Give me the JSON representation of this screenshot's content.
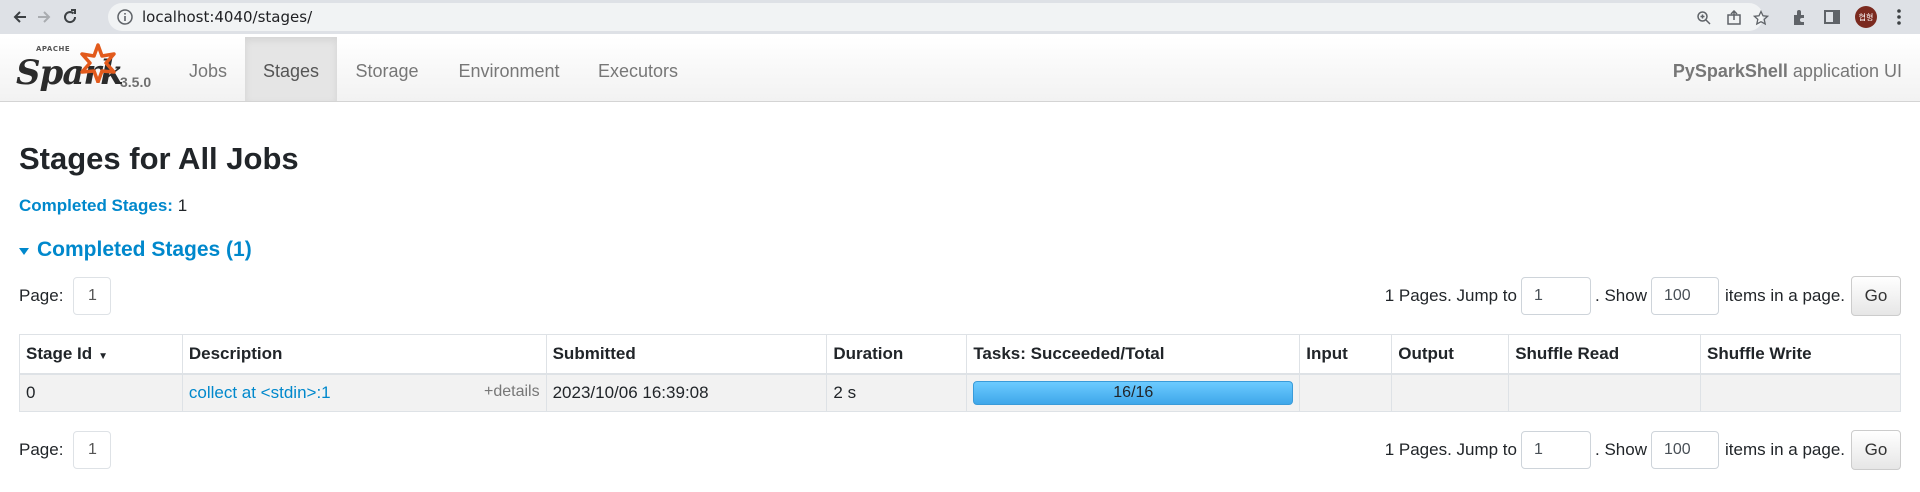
{
  "browser": {
    "url": "localhost:4040/stages/",
    "profile_initials": "협형"
  },
  "navbar": {
    "brand_top": "APACHE",
    "brand_word": "Spark",
    "version": "3.5.0",
    "tabs": [
      {
        "label": "Jobs",
        "active": false
      },
      {
        "label": "Stages",
        "active": true
      },
      {
        "label": "Storage",
        "active": false
      },
      {
        "label": "Environment",
        "active": false
      },
      {
        "label": "Executors",
        "active": false
      }
    ],
    "app_name": "PySparkShell",
    "app_suffix": " application UI"
  },
  "page": {
    "title": "Stages for All Jobs",
    "summary_label": "Completed Stages:",
    "summary_value": " 1",
    "section_title": "Completed Stages (1)"
  },
  "pager": {
    "page_label": "Page:",
    "page_number": "1",
    "pages_text": "1 Pages. Jump to",
    "jump_value": "1",
    "show_text": ". Show",
    "show_value": "100",
    "items_text": "items in a page.",
    "go_label": "Go"
  },
  "table": {
    "headers": [
      "Stage Id",
      "Description",
      "Submitted",
      "Duration",
      "Tasks: Succeeded/Total",
      "Input",
      "Output",
      "Shuffle Read",
      "Shuffle Write"
    ],
    "sort_indicator": "▼",
    "rows": [
      {
        "stage_id": "0",
        "description": "collect at <stdin>:1",
        "details": "+details",
        "submitted": "2023/10/06 16:39:08",
        "duration": "2 s",
        "tasks": "16/16",
        "tasks_fraction": 1.0,
        "input": "",
        "output": "",
        "shuffle_read": "",
        "shuffle_write": ""
      }
    ]
  },
  "colors": {
    "link": "#0088cc",
    "progress": "#50b8f4",
    "spark_star": "#e25a1c"
  }
}
